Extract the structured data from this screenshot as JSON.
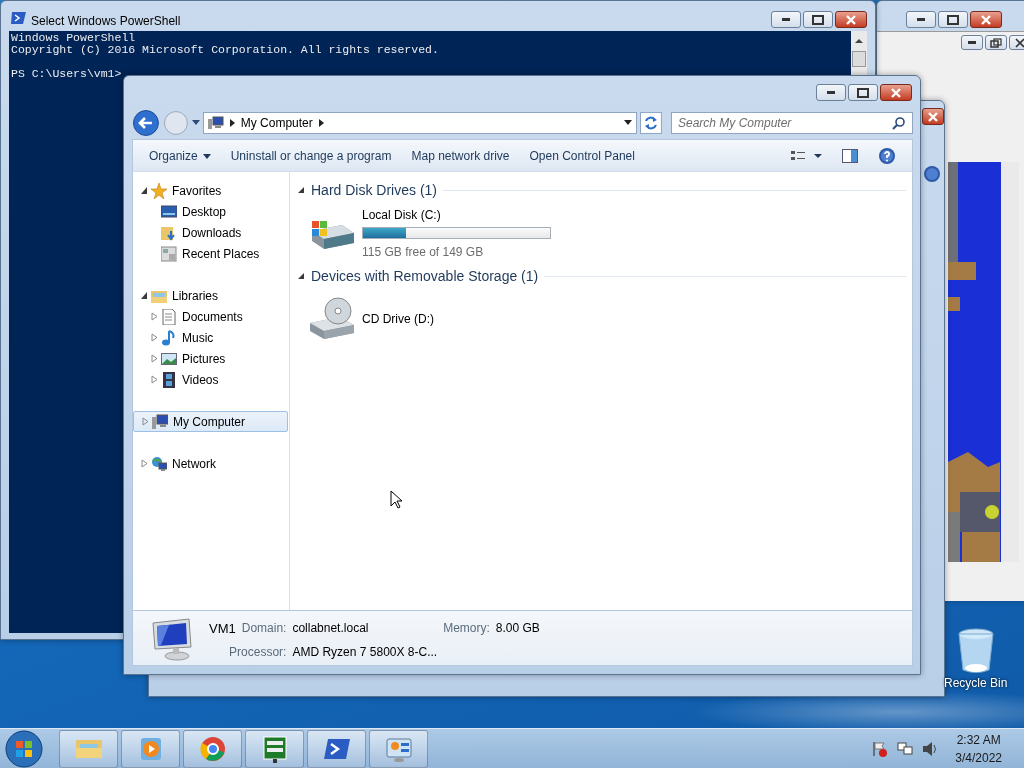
{
  "powershell": {
    "title": "Select Windows PowerShell",
    "header_lines": [
      "Windows PowerShell",
      "Copyright (C) 2016 Microsoft Corporation. All rights reserved."
    ],
    "prompt": "PS C:\\Users\\vm1>"
  },
  "explorer": {
    "address": "My Computer",
    "search": {
      "placeholder": "Search My Computer"
    },
    "toolbar": [
      {
        "label": "Organize",
        "kind": "menu"
      },
      {
        "label": "Uninstall or change a program",
        "kind": "plain"
      },
      {
        "label": "Map network drive",
        "kind": "plain"
      },
      {
        "label": "Open Control Panel",
        "kind": "plain"
      }
    ],
    "sidebar": [
      {
        "label": "Favorites",
        "expanded": true,
        "selected": false,
        "children": [
          {
            "label": "Desktop",
            "selected": false
          },
          {
            "label": "Downloads",
            "selected": false
          },
          {
            "label": "Recent Places",
            "selected": false
          }
        ]
      },
      {
        "label": "Libraries",
        "expanded": true,
        "selected": false,
        "children": [
          {
            "label": "Documents",
            "expanded": false,
            "selected": false
          },
          {
            "label": "Music",
            "expanded": false,
            "selected": false
          },
          {
            "label": "Pictures",
            "expanded": false,
            "selected": false
          },
          {
            "label": "Videos",
            "expanded": false,
            "selected": false
          }
        ]
      },
      {
        "label": "My Computer",
        "expanded": false,
        "selected": true
      },
      {
        "label": "Network",
        "expanded": false,
        "selected": false
      }
    ],
    "groups": [
      {
        "title": "Hard Disk Drives (1)",
        "expanded": true,
        "items": [
          {
            "kind": "disk",
            "name": "Local Disk (C:)",
            "level": 0.23,
            "free": "115 GB free of 149 GB"
          }
        ]
      },
      {
        "title": "Devices with Removable Storage (1)",
        "expanded": true,
        "items": [
          {
            "kind": "cd",
            "name": "CD Drive (D:)"
          }
        ]
      }
    ],
    "details": {
      "name": "VM1",
      "fields": [
        {
          "label": "Domain:",
          "value": "collabnet.local"
        },
        {
          "label": "Memory:",
          "value": "8.00 GB"
        },
        {
          "label": "Processor:",
          "value": "AMD Ryzen 7 5800X 8-C..."
        }
      ]
    }
  },
  "desktop": {
    "icons": [
      {
        "label": "Recycle Bin"
      }
    ]
  },
  "taskbar": {
    "time": "2:32 AM",
    "date": "3/4/2022"
  }
}
